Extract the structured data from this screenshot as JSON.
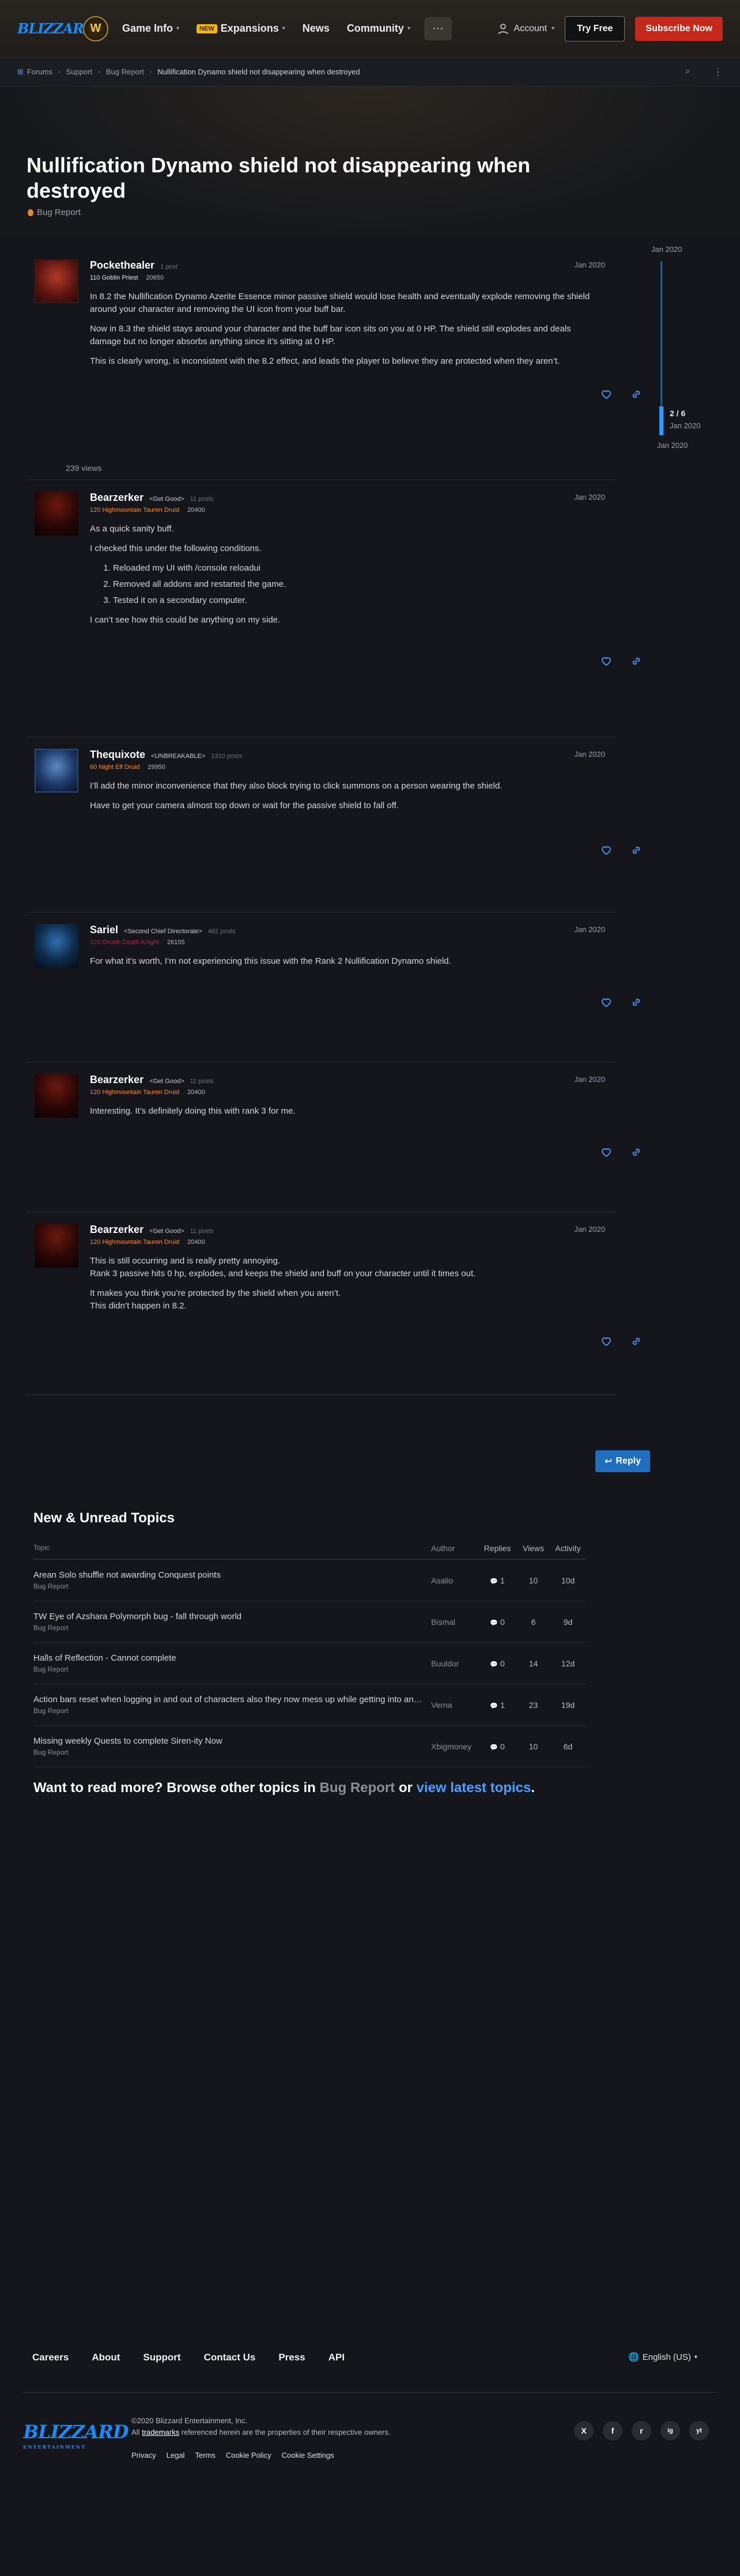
{
  "nav": {
    "logo": "BLIZZARD",
    "game_badge": "W",
    "links": [
      {
        "label": "Game Info",
        "has_caret": true
      },
      {
        "label": "Expansions",
        "badge": "NEW",
        "has_caret": true
      },
      {
        "label": "News",
        "has_caret": false
      },
      {
        "label": "Community",
        "has_caret": true
      }
    ],
    "more": "···",
    "account": "Account",
    "try_free": "Try Free",
    "subscribe": "Subscribe Now"
  },
  "breadcrumb": [
    "Forums",
    "Support",
    "Bug Report",
    "Nullification Dynamo shield not disappearing when destroyed"
  ],
  "topic": {
    "title": "Nullification Dynamo shield not disappearing when destroyed",
    "category": "Bug Report"
  },
  "timeline": {
    "top_date": "Jan 2020",
    "position": "2 / 6",
    "position_date": "Jan 2020",
    "bottom_date": "Jan 2020"
  },
  "views": "239 views",
  "posts": [
    {
      "author": "Pockethealer",
      "title": "",
      "post_count": "1 post",
      "class": "110 Goblin Priest",
      "score": "20650",
      "date": "Jan 2020",
      "paragraphs": [
        "In 8.2 the Nullification Dynamo Azerite Essence minor passive shield would lose health and eventually explode removing the shield around your character and removing the UI icon from your buff bar.",
        "Now in 8.3 the shield stays around your character and the buff bar icon sits on you at 0 HP. The shield still explodes and deals damage but no longer absorbs anything since it’s sitting at 0 HP.",
        "This is clearly wrong, is inconsistent with the 8.2 effect, and leads the player to believe they are protected when they aren’t."
      ]
    },
    {
      "author": "Bearzerker",
      "title": "<Get Good>",
      "post_count": "11 posts",
      "class": "120 Highmountain Tauren Druid",
      "score": "20400",
      "date": "Jan 2020",
      "paragraphs_before": [
        "As a quick sanity buff.",
        "I checked this under the following conditions."
      ],
      "list": [
        "Reloaded my UI with /console reloadui",
        "Removed all addons and restarted the game.",
        "Tested it on a secondary computer."
      ],
      "paragraphs_after": [
        "I can’t see how this could be anything on my side."
      ]
    },
    {
      "author": "Thequixote",
      "title": "<UNBREAKABLE>",
      "post_count": "1310 posts",
      "class": "60 Night Elf Druid",
      "score": "29950",
      "date": "Jan 2020",
      "paragraphs": [
        "I’ll add the minor inconvenience that they also block trying to click summons on a person wearing the shield.",
        "Have to get your camera almost top down or wait for the passive shield to fall off."
      ]
    },
    {
      "author": "Sariel",
      "title": "<Second Chief Directorate>",
      "post_count": "482 posts",
      "class": "120 Orcish Death Knight",
      "score": "26155",
      "date": "Jan 2020",
      "paragraphs": [
        "For what it’s worth, I’m not experiencing this issue with the Rank 2 Nullification Dynamo shield."
      ]
    },
    {
      "author": "Bearzerker",
      "title": "<Get Good>",
      "post_count": "11 posts",
      "class": "120 Highmountain Tauren Druid",
      "score": "20400",
      "date": "Jan 2020",
      "paragraphs": [
        "Interesting. It’s definitely doing this with rank 3 for me."
      ]
    },
    {
      "author": "Bearzerker",
      "title": "<Get Good>",
      "post_count": "11 posts",
      "class": "120 Highmountain Tauren Druid",
      "score": "20400",
      "date": "Jan 2020",
      "paragraphs": [
        "This is still occurring and is really pretty annoying.\nRank 3 passive hits 0 hp, explodes, and keeps the shield and buff on your character until it times out.",
        "It makes you think you’re protected by the shield when you aren’t.\nThis didn’t happen in 8.2."
      ]
    }
  ],
  "reply_button": "Reply",
  "suggested": {
    "heading": "New & Unread Topics",
    "columns": [
      "Topic",
      "Author",
      "Replies",
      "Views",
      "Activity"
    ],
    "rows": [
      {
        "title": "Arean Solo shuffle not awarding Conquest points",
        "category": "Bug Report",
        "author": "Asalio",
        "replies": "1",
        "views": "10",
        "activity": "10d"
      },
      {
        "title": "TW Eye of Azshara Polymorph bug - fall through world",
        "category": "Bug Report",
        "author": "Bismal",
        "replies": "0",
        "views": "6",
        "activity": "9d"
      },
      {
        "title": "Halls of Reflection - Cannot complete",
        "category": "Bug Report",
        "author": "Buuldor",
        "replies": "0",
        "views": "14",
        "activity": "12d"
      },
      {
        "title": "Action bars reset when logging in and out of characters also they now mess up while getting into and out of vehicles",
        "category": "Bug Report",
        "author": "Verna",
        "replies": "1",
        "views": "23",
        "activity": "19d"
      },
      {
        "title": "Missing weekly Quests to complete Siren-ity Now",
        "category": "Bug Report",
        "author": "Xbigmoney",
        "replies": "0",
        "views": "10",
        "activity": "6d"
      }
    ],
    "browse_prefix": "Want to read more? Browse other topics in",
    "browse_category": "Bug Report",
    "browse_or": "or",
    "browse_latest": "view latest topics",
    "browse_suffix": "."
  },
  "footer": {
    "links": [
      "Careers",
      "About",
      "Support",
      "Contact Us",
      "Press",
      "API"
    ],
    "language": "English (US)",
    "logo": "BLIZZARD",
    "logo_sub": "ENTERTAINMENT",
    "copyright_line1": "©2020 Blizzard Entertainment, Inc.",
    "copyright_prefix": "All",
    "copyright_link": "trademarks",
    "copyright_suffix": "referenced herein are the properties of their respective owners.",
    "legal": [
      "Privacy",
      "Legal",
      "Terms",
      "Cookie Policy",
      "Cookie Settings"
    ],
    "socials": [
      "X",
      "f",
      "r",
      "ig",
      "yt"
    ]
  }
}
